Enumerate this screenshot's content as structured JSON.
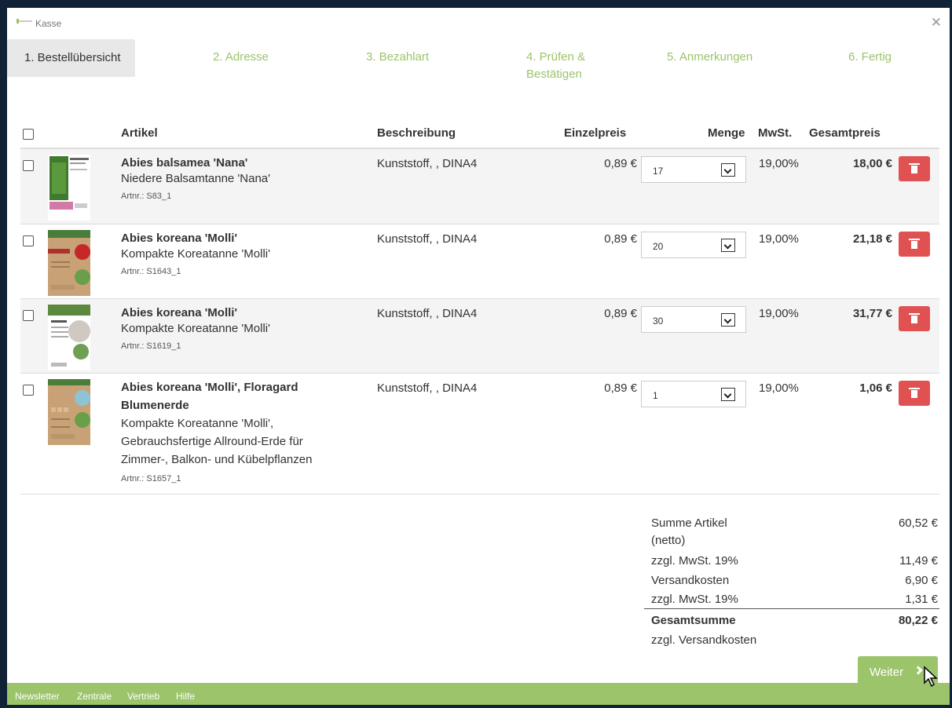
{
  "window": {
    "title": "Kasse"
  },
  "steps": [
    "1. Bestellübersicht",
    "2. Adresse",
    "3. Bezahlart",
    "4. Prüfen &",
    "Bestätigen",
    "5. Anmerkungen",
    "6. Fertig"
  ],
  "table": {
    "headers": {
      "artikel": "Artikel",
      "beschreibung": "Beschreibung",
      "einzelpreis": "Einzelpreis",
      "menge": "Menge",
      "mwst": "MwSt.",
      "gesamtpreis": "Gesamtpreis"
    },
    "rows": [
      {
        "name1": "Abies balsamea 'Nana'",
        "desc1": "Niedere Balsamtanne 'Nana'",
        "nr": "Artnr.: S83_1",
        "beschreibung": "Kunststoff, , DINA4",
        "preis": "0,89 €",
        "menge": "17",
        "mwst": "19,00%",
        "gesamt": "18,00 €"
      },
      {
        "name1": "Abies koreana 'Molli'",
        "desc1": "Kompakte Koreatanne 'Molli'",
        "nr": "Artnr.: S1643_1",
        "beschreibung": "Kunststoff, , DINA4",
        "preis": "0,89 €",
        "menge": "20",
        "mwst": "19,00%",
        "gesamt": "21,18 €"
      },
      {
        "name1": "Abies koreana 'Molli'",
        "desc1": "Kompakte Koreatanne 'Molli'",
        "nr": "Artnr.: S1619_1",
        "beschreibung": "Kunststoff, , DINA4",
        "preis": "0,89 €",
        "menge": "30",
        "mwst": "19,00%",
        "gesamt": "31,77 €"
      },
      {
        "name1": "Abies koreana 'Molli', Floragard",
        "name2": "Blumenerde",
        "desc1": "Kompakte Koreatanne 'Molli',",
        "desc2": "Gebrauchsfertige Allround-Erde für",
        "desc3": "Zimmer-, Balkon- und Kübelpflanzen",
        "nr": "Artnr.: S1657_1",
        "beschreibung": "Kunststoff, , DINA4",
        "preis": "0,89 €",
        "menge": "1",
        "mwst": "19,00%",
        "gesamt": "1,06 €"
      }
    ]
  },
  "summary": {
    "summe_label": "Summe Artikel",
    "summe_label2": "(netto)",
    "summe_val": "60,52 €",
    "mwst1_label": "zzgl. MwSt. 19%",
    "mwst1_val": "11,49 €",
    "versand_label": "Versandkosten",
    "versand_val": "6,90 €",
    "mwst2_label": "zzgl. MwSt. 19%",
    "mwst2_val": "1,31 €",
    "gesamt_label": "Gesamtsumme",
    "gesamt_val": "80,22 €",
    "gesamt_note": "zzgl. Versandkosten"
  },
  "next_button": "Weiter",
  "footer": [
    "Newsletter",
    "Zentrale",
    "Vertrieb",
    "Hilfe"
  ],
  "colors": {
    "accent": "#9cc46a",
    "danger": "#e05252"
  }
}
